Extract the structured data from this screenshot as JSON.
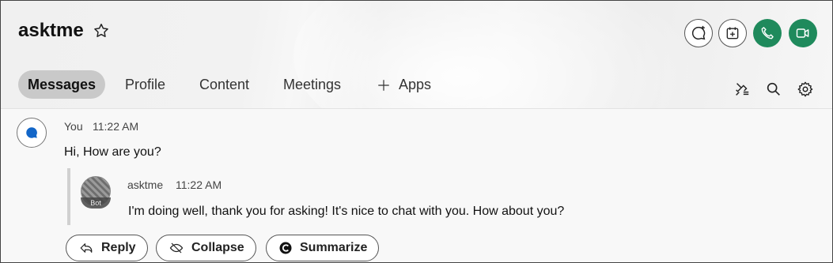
{
  "header": {
    "title": "asktme",
    "icons": {
      "favorite": "star-icon",
      "new_chat": "chat-plus-icon",
      "schedule": "calendar-add-icon",
      "call": "phone-icon",
      "video": "video-icon"
    },
    "colors": {
      "call_green": "#1f8a5c"
    }
  },
  "tabs": [
    {
      "label": "Messages",
      "active": true
    },
    {
      "label": "Profile"
    },
    {
      "label": "Content"
    },
    {
      "label": "Meetings"
    },
    {
      "label": "Apps",
      "icon": "plus-icon"
    }
  ],
  "tab_tools": {
    "icons": [
      "pin-list-icon",
      "search-icon",
      "gear-icon"
    ]
  },
  "thread": {
    "message": {
      "author": "You",
      "time": "11:22 AM",
      "text": "Hi, How are you?"
    },
    "reply": {
      "author": "asktme",
      "time": "11:22 AM",
      "badge": "Bot",
      "text": "I'm doing well, thank you for asking! It's nice to chat with you. How about you?"
    },
    "actions": {
      "reply": "Reply",
      "collapse": "Collapse",
      "summarize": "Summarize"
    }
  }
}
